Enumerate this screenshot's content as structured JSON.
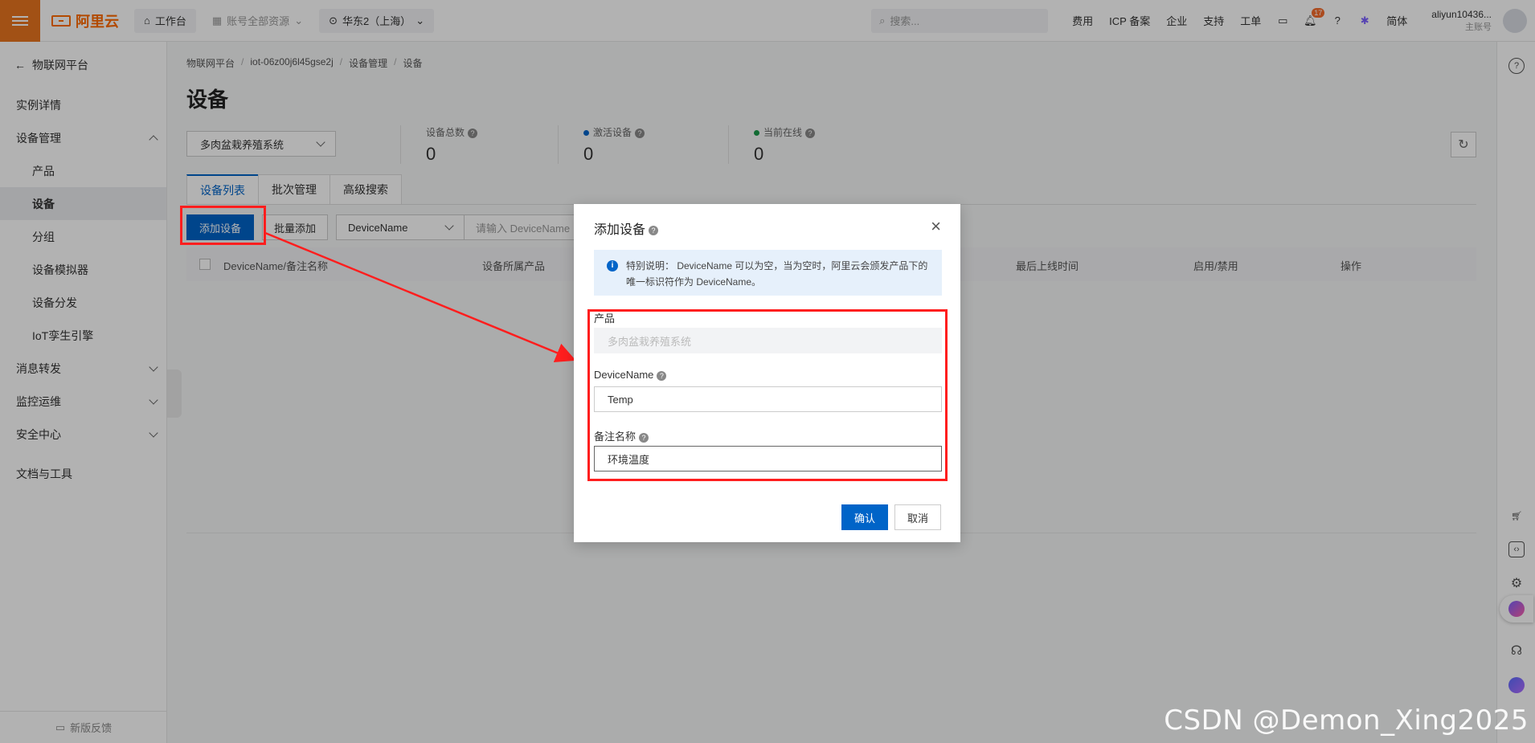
{
  "topbar": {
    "logo": "阿里云",
    "workbench": "工作台",
    "resources": "账号全部资源",
    "region": "华东2（上海）",
    "search_placeholder": "搜索...",
    "links": [
      "费用",
      "ICP 备案",
      "企业",
      "支持",
      "工单"
    ],
    "notify_count": "17",
    "lang": "简体",
    "user_name": "aliyun10436...",
    "user_role": "主账号"
  },
  "sidebar": {
    "back": "物联网平台",
    "items": [
      {
        "label": "实例详情"
      },
      {
        "label": "设备管理"
      },
      {
        "label": "产品"
      },
      {
        "label": "设备"
      },
      {
        "label": "分组"
      },
      {
        "label": "设备模拟器"
      },
      {
        "label": "设备分发"
      },
      {
        "label": "IoT孪生引擎"
      },
      {
        "label": "消息转发"
      },
      {
        "label": "监控运维"
      },
      {
        "label": "安全中心"
      },
      {
        "label": "文档与工具"
      }
    ],
    "feedback": "新版反馈"
  },
  "main": {
    "breadcrumb": [
      "物联网平台",
      "iot-06z00j6l45gse2j",
      "设备管理",
      "设备"
    ],
    "title": "设备",
    "product_select": "多肉盆栽养殖系统",
    "stats": [
      {
        "label": "设备总数",
        "value": "0"
      },
      {
        "label": "激活设备",
        "value": "0"
      },
      {
        "label": "当前在线",
        "value": "0"
      }
    ],
    "tabs": [
      "设备列表",
      "批次管理",
      "高级搜索"
    ],
    "add_device": "添加设备",
    "batch_add": "批量添加",
    "filter_field": "DeviceName",
    "filter_placeholder": "请输入 DeviceName",
    "columns": [
      "DeviceName/备注名称",
      "设备所属产品",
      "最后上线时间",
      "启用/禁用",
      "操作"
    ]
  },
  "dialog": {
    "title": "添加设备",
    "notice": "特别说明： DeviceName 可以为空，当为空时，阿里云会颁发产品下的唯一标识符作为 DeviceName。",
    "product_label": "产品",
    "product_value": "多肉盆栽养殖系统",
    "devicename_label": "DeviceName",
    "devicename_value": "Temp",
    "remark_label": "备注名称",
    "remark_value": "环境温度",
    "ok": "确认",
    "cancel": "取消"
  },
  "colors": {
    "primary": "#0064c8",
    "brand": "#ff6a00",
    "highlight": "#ff1e1e"
  },
  "watermark": "CSDN @Demon_Xing2025"
}
